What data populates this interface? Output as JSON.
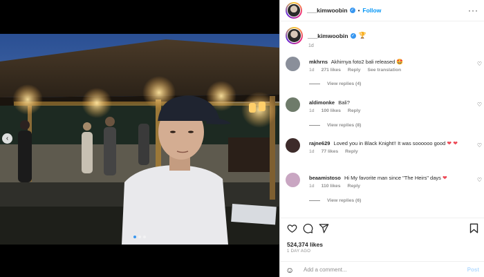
{
  "post": {
    "author": "___kimwoobin",
    "follow_label": "Follow",
    "separator": "•",
    "more_icon": "more-horizontal-icon",
    "caption_emoji": "🏆",
    "caption_time": "1d",
    "likes": "524,374 likes",
    "posted_ago": "1 DAY AGO"
  },
  "comments": [
    {
      "user": "mkhrns",
      "text": "Akhirnya foto2 bali released",
      "emoji": "🤩",
      "time": "1d",
      "likes": "271 likes",
      "reply": "Reply",
      "extra": "See translation",
      "replies": "View replies (4)",
      "avatar_color": "#8a8f9a"
    },
    {
      "user": "aldimonke",
      "text": "Bali?",
      "emoji": "",
      "time": "1d",
      "likes": "100 likes",
      "reply": "Reply",
      "extra": "",
      "replies": "View replies (8)",
      "avatar_color": "#6e7b6a"
    },
    {
      "user": "rajne629",
      "text": "Loved you in Black Knight!! It was soooooo good",
      "emoji": "❤",
      "emoji2": "❤",
      "time": "1d",
      "likes": "77 likes",
      "reply": "Reply",
      "extra": "",
      "replies": "",
      "avatar_color": "#3d2b2a"
    },
    {
      "user": "beaamistoso",
      "text": "Hi My favorite man since \"The Heirs\" days",
      "emoji": "❤",
      "time": "1d",
      "likes": "110 likes",
      "reply": "Reply",
      "extra": "",
      "replies": "View replies (6)",
      "avatar_color": "#c9a6c2"
    }
  ],
  "composer": {
    "placeholder": "Add a comment...",
    "post_label": "Post"
  },
  "colors": {
    "link_blue": "#0095f6",
    "verified_blue": "#3897f0",
    "heart_red": "#ed4956"
  },
  "carousel": {
    "total_slides": 3,
    "active_slide": 1
  }
}
